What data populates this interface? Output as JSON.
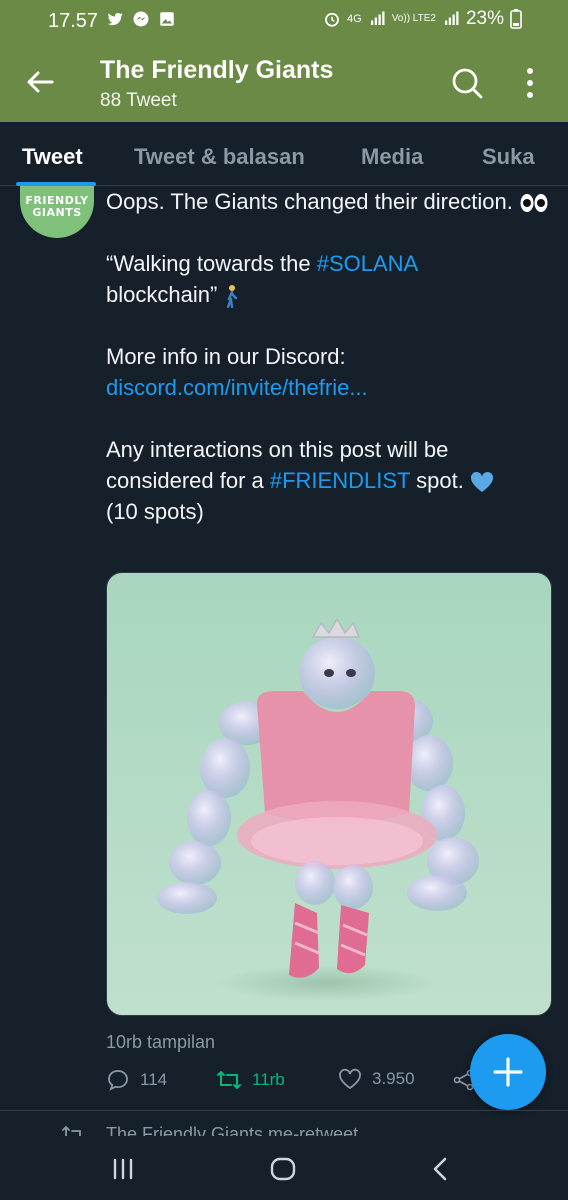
{
  "status_bar": {
    "time": "17.57",
    "net_label": "4G",
    "volte_label": "Vo)) LTE2",
    "battery": "23%"
  },
  "header": {
    "title": "The Friendly Giants",
    "subtitle": "88 Tweet",
    "icons": [
      "back-arrow-icon",
      "search-icon",
      "more-vertical-icon"
    ]
  },
  "tabs": [
    {
      "label": "Tweet",
      "active": true
    },
    {
      "label": "Tweet & balasan",
      "active": false
    },
    {
      "label": "Media",
      "active": false
    },
    {
      "label": "Suka",
      "active": false
    }
  ],
  "avatar": {
    "line1": "FRIENDLY",
    "line2": "GIANTS"
  },
  "tweet": {
    "line1": "Oops. The Giants changed their direction.",
    "quote_prefix": "“Walking towards the ",
    "hashtag1": "#SOLANA",
    "quote_suffix": "blockchain”",
    "info": "More info in our Discord:",
    "link": "discord.com/invite/thefrie...",
    "cta_prefix": "Any interactions on this post will be considered for a ",
    "hashtag2": "#FRIENDLIST",
    "cta_suffix": " spot.",
    "spots": "(10 spots)"
  },
  "views": "10rb tampilan",
  "actions": {
    "replies": "114",
    "retweets": "11rb",
    "likes": "3.950"
  },
  "next_item": "The Friendly Giants me-retweet",
  "colors": {
    "header_bg": "#6a8a45",
    "background": "#15202b",
    "accent": "#1d9bf0",
    "retweet": "#00ba7c",
    "muted": "#8b98a5"
  }
}
